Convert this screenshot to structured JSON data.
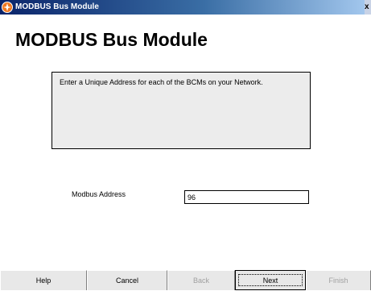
{
  "window": {
    "title": "MODBUS Bus Module",
    "icon": "app-compass-icon",
    "close_label": "x"
  },
  "page": {
    "heading": "MODBUS Bus Module",
    "instructions": "Enter a Unique Address for each of the BCMs on your Network."
  },
  "form": {
    "modbus_address_label": "Modbus Address",
    "modbus_address_value": "96"
  },
  "buttons": {
    "help": "Help",
    "cancel": "Cancel",
    "back": "Back",
    "next": "Next",
    "finish": "Finish"
  },
  "colors": {
    "titlebar_start": "#0a246a",
    "titlebar_end": "#a6caf0",
    "icon_orange": "#f07820"
  }
}
